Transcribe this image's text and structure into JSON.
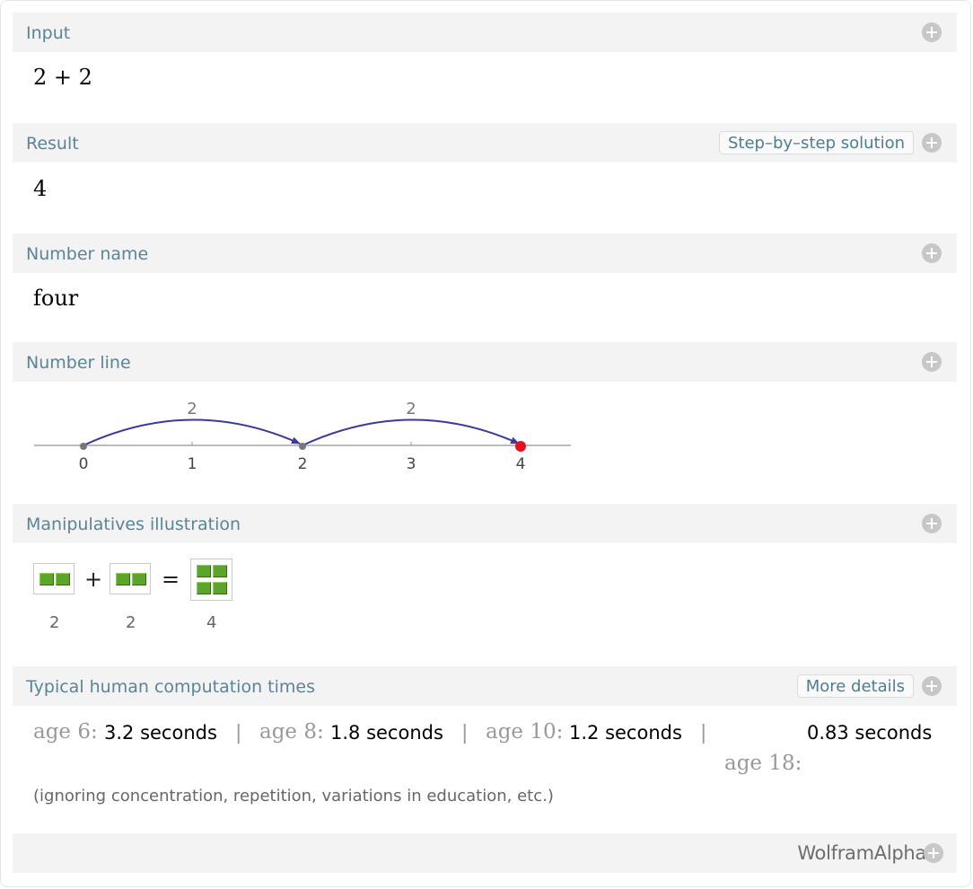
{
  "pods": {
    "input": {
      "title": "Input",
      "value": "2 + 2"
    },
    "result": {
      "title": "Result",
      "value": "4",
      "button": "Step–by–step solution"
    },
    "number_name": {
      "title": "Number name",
      "value": "four"
    },
    "number_line": {
      "title": "Number line",
      "ticks": [
        "0",
        "1",
        "2",
        "3",
        "4"
      ],
      "jumps": [
        "2",
        "2"
      ]
    },
    "manipulatives": {
      "title": "Manipulatives illustration",
      "plus": "+",
      "equals": "=",
      "labels": [
        "2",
        "2",
        "4"
      ]
    },
    "computation_times": {
      "title": "Typical human computation times",
      "button": "More details",
      "entries": [
        {
          "age": "age 6:",
          "time": "3.2 seconds"
        },
        {
          "age": "age 8:",
          "time": "1.8 seconds"
        },
        {
          "age": "age 10:",
          "time": "1.2 seconds"
        },
        {
          "age": "age 18:",
          "time": "0.83 seconds"
        }
      ],
      "separator": "|",
      "note": "(ignoring concentration, repetition, variations in education, etc.)"
    }
  },
  "footer": {
    "brand": "WolframAlpha"
  },
  "colors": {
    "header_bg": "#f3f3f3",
    "title": "#5a8497",
    "arc": "#3a3a9a",
    "endpoint": "#e8101e",
    "block": "#5aa52a"
  },
  "icons": [
    "plus-circle-icon"
  ]
}
